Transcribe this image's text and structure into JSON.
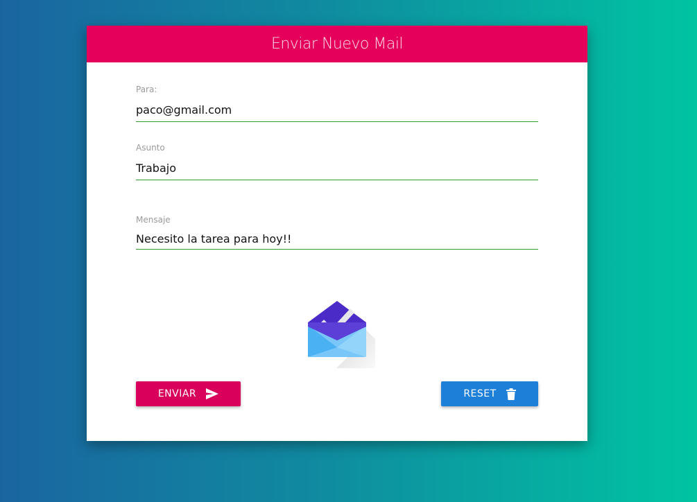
{
  "header": {
    "title": "Enviar Nuevo Mail"
  },
  "form": {
    "to": {
      "label": "Para:",
      "value": "paco@gmail.com"
    },
    "subject": {
      "label": "Asunto",
      "value": "Trabajo"
    },
    "message": {
      "label": "Mensaje",
      "value": "Necesito la tarea para hoy!!"
    }
  },
  "logo": {
    "icon": "inbox-envelope-check-icon"
  },
  "buttons": {
    "send_label": "ENVIAR",
    "send_icon": "send-icon",
    "reset_label": "RESET",
    "reset_icon": "trash-icon"
  },
  "colors": {
    "header": "#e5005b",
    "send_button": "#d8005a",
    "reset_button": "#1e7fd8",
    "input_underline": "#2e9a2e"
  }
}
